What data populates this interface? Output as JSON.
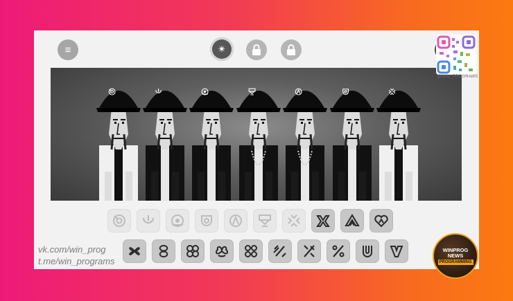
{
  "toolbar": {
    "menu_icon": "menu-icon",
    "bonus_icon": "sparkle-icon",
    "lock_icon": "lock-icon",
    "play_icon": "play-icon"
  },
  "characters": [
    {
      "name": "character-1",
      "hat_icon": "target-ring",
      "outfit": "white-jacket"
    },
    {
      "name": "character-2",
      "hat_icon": "power-cup",
      "outfit": "dark-jacket"
    },
    {
      "name": "character-3",
      "hat_icon": "target-dot",
      "outfit": "dark-hoodie"
    },
    {
      "name": "character-4",
      "hat_icon": "trophy-box",
      "outfit": "chain-necklace"
    },
    {
      "name": "character-5",
      "hat_icon": "arc-a",
      "outfit": "vest-chain"
    },
    {
      "name": "character-6",
      "hat_icon": "shield-circle",
      "outfit": "dark-vest"
    },
    {
      "name": "character-7",
      "hat_icon": "spark-burst",
      "outfit": "white-shirt"
    }
  ],
  "beats_row": [
    {
      "icon": "target-ring",
      "active": false
    },
    {
      "icon": "power-cup",
      "active": false
    },
    {
      "icon": "target-dot",
      "active": false
    },
    {
      "icon": "shield-circle",
      "active": false
    },
    {
      "icon": "arc-a",
      "active": false
    },
    {
      "icon": "trophy-box",
      "active": false
    },
    {
      "icon": "spark-burst",
      "active": false
    },
    {
      "icon": "m-fold",
      "active": true
    },
    {
      "icon": "a-fold",
      "active": true
    },
    {
      "icon": "heart-fold",
      "active": true
    }
  ],
  "voices_row": [
    {
      "icon": "clover-a",
      "active": true
    },
    {
      "icon": "clover-b",
      "active": true
    },
    {
      "icon": "clover-c",
      "active": true
    },
    {
      "icon": "clover-d",
      "active": true
    },
    {
      "icon": "clover-e",
      "active": true
    },
    {
      "icon": "percent-a",
      "active": true
    },
    {
      "icon": "percent-b",
      "active": true
    },
    {
      "icon": "percent-c",
      "active": true
    },
    {
      "icon": "loop-u",
      "active": true
    },
    {
      "icon": "loop-v",
      "active": true
    }
  ],
  "qr_caption": "@WIN_PROGRAMS",
  "watermark": {
    "line1": "vk.com/win_prog",
    "line2": "t.me/win_programs"
  },
  "badge": {
    "line1": "WINPROG",
    "line2": "NEWS",
    "line3": "PROGRAMMING"
  }
}
